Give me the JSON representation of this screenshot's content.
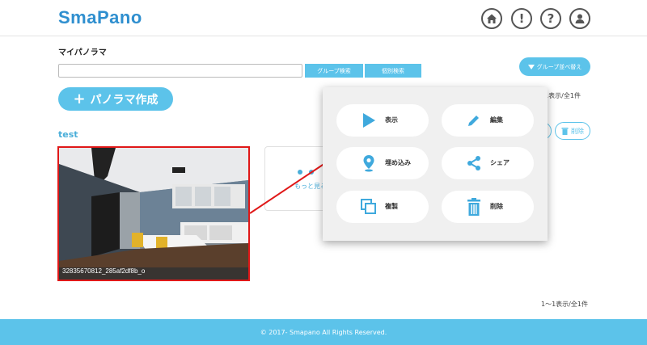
{
  "header": {
    "logo": "SmaPano",
    "icons": [
      "home-icon",
      "info-icon",
      "help-icon",
      "user-icon"
    ],
    "info_glyph": "!",
    "help_glyph": "?"
  },
  "section_title": "マイパノラマ",
  "search": {
    "value": "",
    "placeholder": ""
  },
  "buttons": {
    "group_search": "グループ検索",
    "individual_search": "個別検索",
    "sort_groups": "グループ並べ替え",
    "create": "パノラマ作成",
    "create_plus": "+"
  },
  "count_top": "1〜1表示/全1件",
  "count_bottom": "1〜1表示/全1件",
  "group": {
    "name": "test",
    "delete_label": "削除",
    "edit_glyph": "✎"
  },
  "panorama": {
    "caption": "32835670812_285af2df8b_o"
  },
  "more": {
    "label": "もっと見る"
  },
  "popup_menu": [
    {
      "label": "表示",
      "icon": "play-icon"
    },
    {
      "label": "編集",
      "icon": "pencil-icon"
    },
    {
      "label": "埋め込み",
      "icon": "location-pin-icon"
    },
    {
      "label": "シェア",
      "icon": "share-icon"
    },
    {
      "label": "複製",
      "icon": "duplicate-icon"
    },
    {
      "label": "削除",
      "icon": "trash-icon"
    }
  ],
  "footer": "© 2017- Smapano All Rights Reserved.",
  "colors": {
    "accent": "#5cc3ea",
    "logo": "#2f8fcf",
    "highlight": "#e01818"
  }
}
